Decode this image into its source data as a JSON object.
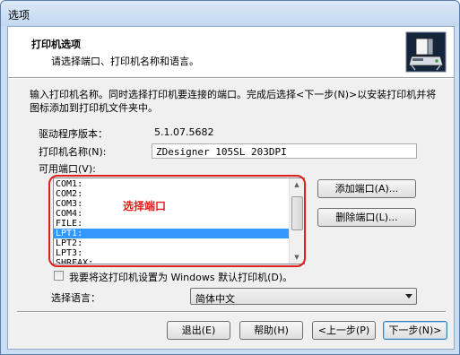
{
  "window": {
    "title": "选项"
  },
  "header": {
    "title": "打印机选项",
    "subtitle": "请选择端口、打印机名称和语言。"
  },
  "instruction": "输入打印机名称。同时选择打印机要连接的端口。完成后选择<下一步(N)>以安装打印机并将图标添加到打印机文件夹中。",
  "driver": {
    "label": "驱动程序版本：",
    "value": "5.1.07.5682"
  },
  "printer_name": {
    "label": "打印机名称(N):",
    "value": "ZDesigner 105SL 203DPI"
  },
  "ports": {
    "label": "可用端口(V):",
    "items": [
      "COM1:",
      "COM2:",
      "COM3:",
      "COM4:",
      "FILE:",
      "LPT1:",
      "LPT2:",
      "LPT3:",
      "SHRFAX:"
    ],
    "selected_index": 5,
    "annotation": "选择端口",
    "annotation_color": "#e0201d"
  },
  "buttons": {
    "add_port": "添加端口(A)...",
    "delete_port": "删除端口(L)...",
    "exit": "退出(E)",
    "help": "帮助(H)",
    "back": "<上一步(P)",
    "next": "下一步(N)>"
  },
  "default_checkbox": {
    "label": "我要将这打印机设置为 Windows 默认打印机(D)。",
    "checked": false
  },
  "language": {
    "label": "选择语言：",
    "value": "简体中文"
  },
  "colors": {
    "selection": "#3399ff",
    "frame": "#c9def2",
    "annotation": "#e0201d"
  }
}
